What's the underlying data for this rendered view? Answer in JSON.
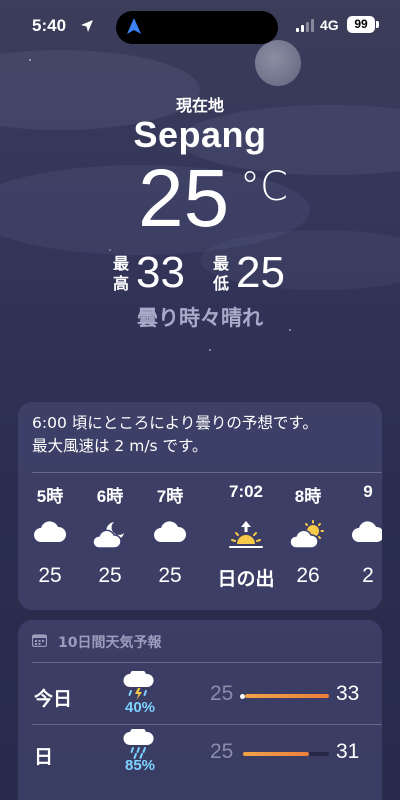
{
  "status_bar": {
    "time": "5:40",
    "network": "4G",
    "battery": "99",
    "location_icon": "location-arrow-icon",
    "signal_icon": "signal-icon"
  },
  "weather": {
    "location_label": "現在地",
    "city": "Sepang",
    "temperature": "25",
    "unit": "°C",
    "high_label": "最高",
    "high": "33",
    "low_label": "最低",
    "low": "25",
    "condition": "曇り時々晴れ"
  },
  "hourly": {
    "summary": "6:00 頃にところにより曇りの予想です。最大風速は 2 m/s です。",
    "items": [
      {
        "time": "5時",
        "icon": "cloud-icon",
        "temp": "25"
      },
      {
        "time": "6時",
        "icon": "cloud-moon-icon",
        "temp": "25"
      },
      {
        "time": "7時",
        "icon": "cloud-icon",
        "temp": "25"
      },
      {
        "time": "7:02",
        "icon": "sunrise-icon",
        "temp": "日の出"
      },
      {
        "time": "8時",
        "icon": "cloud-sun-icon",
        "temp": "26"
      },
      {
        "time": "9",
        "icon": "cloud-icon",
        "temp": "2"
      }
    ]
  },
  "daily": {
    "header": "10日間天気予報",
    "header_icon": "calendar-icon",
    "items": [
      {
        "day": "今日",
        "icon": "thunderstorm-icon",
        "precip": "40%",
        "low": "25",
        "high": "33",
        "range_start": 0.02,
        "range_end": 1.0,
        "current": 0.02
      },
      {
        "day": "日",
        "icon": "rain-icon",
        "precip": "85%",
        "low": "25",
        "high": "31",
        "range_start": 0.0,
        "range_end": 0.77
      }
    ]
  },
  "colors": {
    "background": "#2c2f52",
    "card": "#4a4d78",
    "precip": "#7fd2ff",
    "range_bar": "#ec7e3c"
  }
}
